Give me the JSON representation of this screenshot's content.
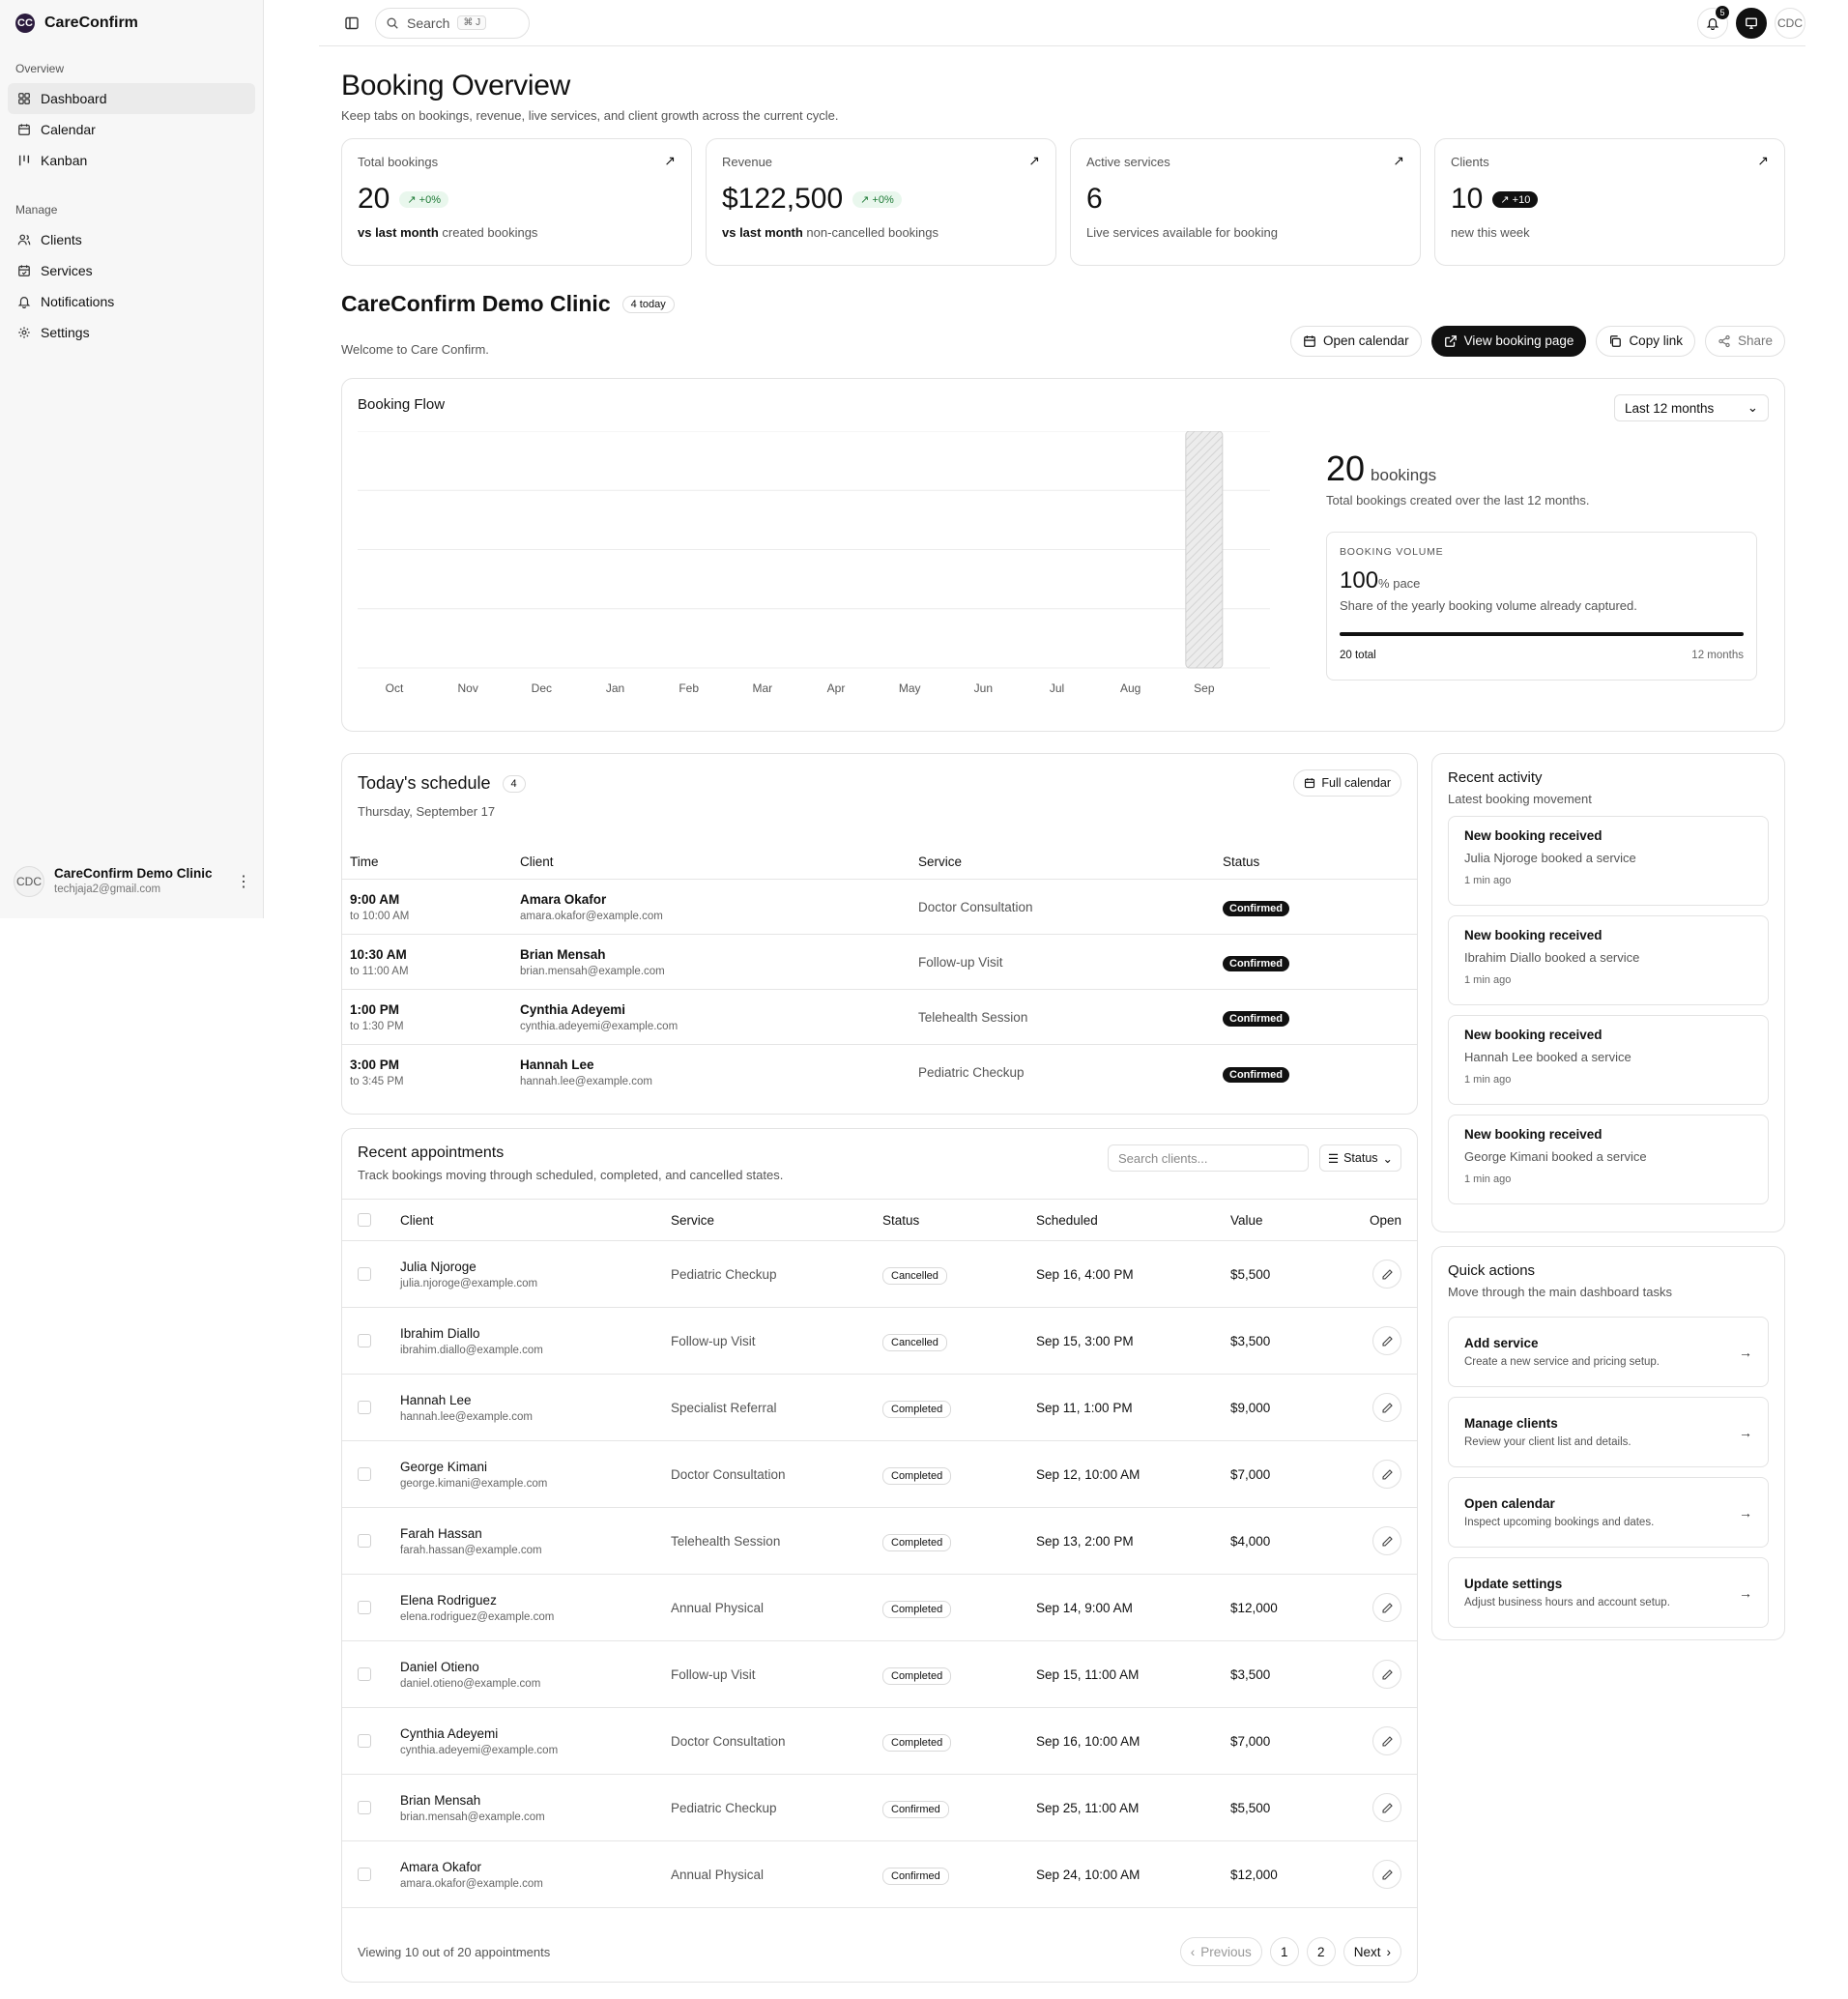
{
  "brand": {
    "name": "CareConfirm",
    "logo": "CC"
  },
  "sidebar": {
    "groups": [
      {
        "title": "Overview",
        "items": [
          {
            "label": "Dashboard",
            "icon": "dashboard-icon"
          },
          {
            "label": "Calendar",
            "icon": "calendar-icon"
          },
          {
            "label": "Kanban",
            "icon": "kanban-icon"
          }
        ]
      },
      {
        "title": "Manage",
        "items": [
          {
            "label": "Clients",
            "icon": "users-icon"
          },
          {
            "label": "Services",
            "icon": "calendar-check-icon"
          },
          {
            "label": "Notifications",
            "icon": "bell-icon"
          },
          {
            "label": "Settings",
            "icon": "gear-icon"
          }
        ]
      }
    ],
    "user": {
      "initials": "CDC",
      "name": "CareConfirm Demo Clinic",
      "email": "techjaja2@gmail.com"
    }
  },
  "topbar": {
    "search_label": "Search",
    "shortcut": "⌘ J",
    "notification_count": "5",
    "avatar": "CDC"
  },
  "page": {
    "title": "Booking Overview",
    "subtitle": "Keep tabs on bookings, revenue, live services, and client growth across the current cycle."
  },
  "stats": [
    {
      "label": "Total bookings",
      "value": "20",
      "badge": "+0%",
      "badge_style": "green",
      "foot_bold": "vs last month",
      "foot": "created bookings"
    },
    {
      "label": "Revenue",
      "value": "$122,500",
      "badge": "+0%",
      "badge_style": "green",
      "foot_bold": "vs last month",
      "foot": "non-cancelled bookings"
    },
    {
      "label": "Active services",
      "value": "6",
      "badge": "",
      "badge_style": "",
      "foot_bold": "",
      "foot": "Live services available for booking"
    },
    {
      "label": "Clients",
      "value": "10",
      "badge": "+10",
      "badge_style": "dark",
      "foot_bold": "",
      "foot": "new this week"
    }
  ],
  "clinic": {
    "name": "CareConfirm Demo Clinic",
    "today_badge": "4 today",
    "welcome": "Welcome to Care Confirm.",
    "actions": {
      "open_calendar": "Open calendar",
      "view_booking": "View booking page",
      "copy_link": "Copy link",
      "share": "Share"
    }
  },
  "booking_flow": {
    "title": "Booking Flow",
    "range": "Last 12 months",
    "total": "20",
    "total_unit": "bookings",
    "description": "Total bookings created over the last 12 months.",
    "volume": {
      "label": "BOOKING VOLUME",
      "value": "100",
      "unit": "% pace",
      "description": "Share of the yearly booking volume already captured.",
      "fraction": 1.0,
      "foot_left": "20 total",
      "foot_right": "12 months"
    }
  },
  "chart_data": {
    "type": "bar",
    "title": "Booking Flow",
    "categories": [
      "Oct",
      "Nov",
      "Dec",
      "Jan",
      "Feb",
      "Mar",
      "Apr",
      "May",
      "Jun",
      "Jul",
      "Aug",
      "Sep"
    ],
    "values": [
      0,
      0,
      0,
      0,
      0,
      0,
      0,
      0,
      0,
      0,
      0,
      20
    ],
    "xlabel": "",
    "ylabel": "",
    "ylim": [
      0,
      20
    ],
    "grid": true,
    "bar_color": "#cfcfcf"
  },
  "schedule": {
    "title": "Today's schedule",
    "count": "4",
    "date": "Thursday, September 17",
    "full_calendar": "Full calendar",
    "columns": [
      "Time",
      "Client",
      "Service",
      "Status"
    ],
    "rows": [
      {
        "time": "9:00 AM",
        "end": "to 10:00 AM",
        "client": "Amara Okafor",
        "email": "amara.okafor@example.com",
        "service": "Doctor Consultation",
        "status": "Confirmed"
      },
      {
        "time": "10:30 AM",
        "end": "to 11:00 AM",
        "client": "Brian Mensah",
        "email": "brian.mensah@example.com",
        "service": "Follow-up Visit",
        "status": "Confirmed"
      },
      {
        "time": "1:00 PM",
        "end": "to 1:30 PM",
        "client": "Cynthia Adeyemi",
        "email": "cynthia.adeyemi@example.com",
        "service": "Telehealth Session",
        "status": "Confirmed"
      },
      {
        "time": "3:00 PM",
        "end": "to 3:45 PM",
        "client": "Hannah Lee",
        "email": "hannah.lee@example.com",
        "service": "Pediatric Checkup",
        "status": "Confirmed"
      }
    ]
  },
  "appointments": {
    "title": "Recent appointments",
    "subtitle": "Track bookings moving through scheduled, completed, and cancelled states.",
    "search_placeholder": "Search clients...",
    "status_filter": "Status",
    "columns": [
      "Client",
      "Service",
      "Status",
      "Scheduled",
      "Value",
      "Open"
    ],
    "rows": [
      {
        "client": "Julia Njoroge",
        "email": "julia.njoroge@example.com",
        "service": "Pediatric Checkup",
        "status": "Cancelled",
        "scheduled": "Sep 16, 4:00 PM",
        "value": "$5,500"
      },
      {
        "client": "Ibrahim Diallo",
        "email": "ibrahim.diallo@example.com",
        "service": "Follow-up Visit",
        "status": "Cancelled",
        "scheduled": "Sep 15, 3:00 PM",
        "value": "$3,500"
      },
      {
        "client": "Hannah Lee",
        "email": "hannah.lee@example.com",
        "service": "Specialist Referral",
        "status": "Completed",
        "scheduled": "Sep 11, 1:00 PM",
        "value": "$9,000"
      },
      {
        "client": "George Kimani",
        "email": "george.kimani@example.com",
        "service": "Doctor Consultation",
        "status": "Completed",
        "scheduled": "Sep 12, 10:00 AM",
        "value": "$7,000"
      },
      {
        "client": "Farah Hassan",
        "email": "farah.hassan@example.com",
        "service": "Telehealth Session",
        "status": "Completed",
        "scheduled": "Sep 13, 2:00 PM",
        "value": "$4,000"
      },
      {
        "client": "Elena Rodriguez",
        "email": "elena.rodriguez@example.com",
        "service": "Annual Physical",
        "status": "Completed",
        "scheduled": "Sep 14, 9:00 AM",
        "value": "$12,000"
      },
      {
        "client": "Daniel Otieno",
        "email": "daniel.otieno@example.com",
        "service": "Follow-up Visit",
        "status": "Completed",
        "scheduled": "Sep 15, 11:00 AM",
        "value": "$3,500"
      },
      {
        "client": "Cynthia Adeyemi",
        "email": "cynthia.adeyemi@example.com",
        "service": "Doctor Consultation",
        "status": "Completed",
        "scheduled": "Sep 16, 10:00 AM",
        "value": "$7,000"
      },
      {
        "client": "Brian Mensah",
        "email": "brian.mensah@example.com",
        "service": "Pediatric Checkup",
        "status": "Confirmed",
        "scheduled": "Sep 25, 11:00 AM",
        "value": "$5,500"
      },
      {
        "client": "Amara Okafor",
        "email": "amara.okafor@example.com",
        "service": "Annual Physical",
        "status": "Confirmed",
        "scheduled": "Sep 24, 10:00 AM",
        "value": "$12,000"
      }
    ],
    "footer": "Viewing 10 out of 20 appointments",
    "pager": {
      "previous": "Previous",
      "next": "Next",
      "pages": [
        "1",
        "2"
      ]
    }
  },
  "activity": {
    "title": "Recent activity",
    "subtitle": "Latest booking movement",
    "items": [
      {
        "title": "New booking received",
        "desc": "Julia Njoroge booked a service",
        "time": "1 min ago"
      },
      {
        "title": "New booking received",
        "desc": "Ibrahim Diallo booked a service",
        "time": "1 min ago"
      },
      {
        "title": "New booking received",
        "desc": "Hannah Lee booked a service",
        "time": "1 min ago"
      },
      {
        "title": "New booking received",
        "desc": "George Kimani booked a service",
        "time": "1 min ago"
      }
    ]
  },
  "quick_actions": {
    "title": "Quick actions",
    "subtitle": "Move through the main dashboard tasks",
    "items": [
      {
        "title": "Add service",
        "desc": "Create a new service and pricing setup."
      },
      {
        "title": "Manage clients",
        "desc": "Review your client list and details."
      },
      {
        "title": "Open calendar",
        "desc": "Inspect upcoming bookings and dates."
      },
      {
        "title": "Update settings",
        "desc": "Adjust business hours and account setup."
      }
    ]
  }
}
